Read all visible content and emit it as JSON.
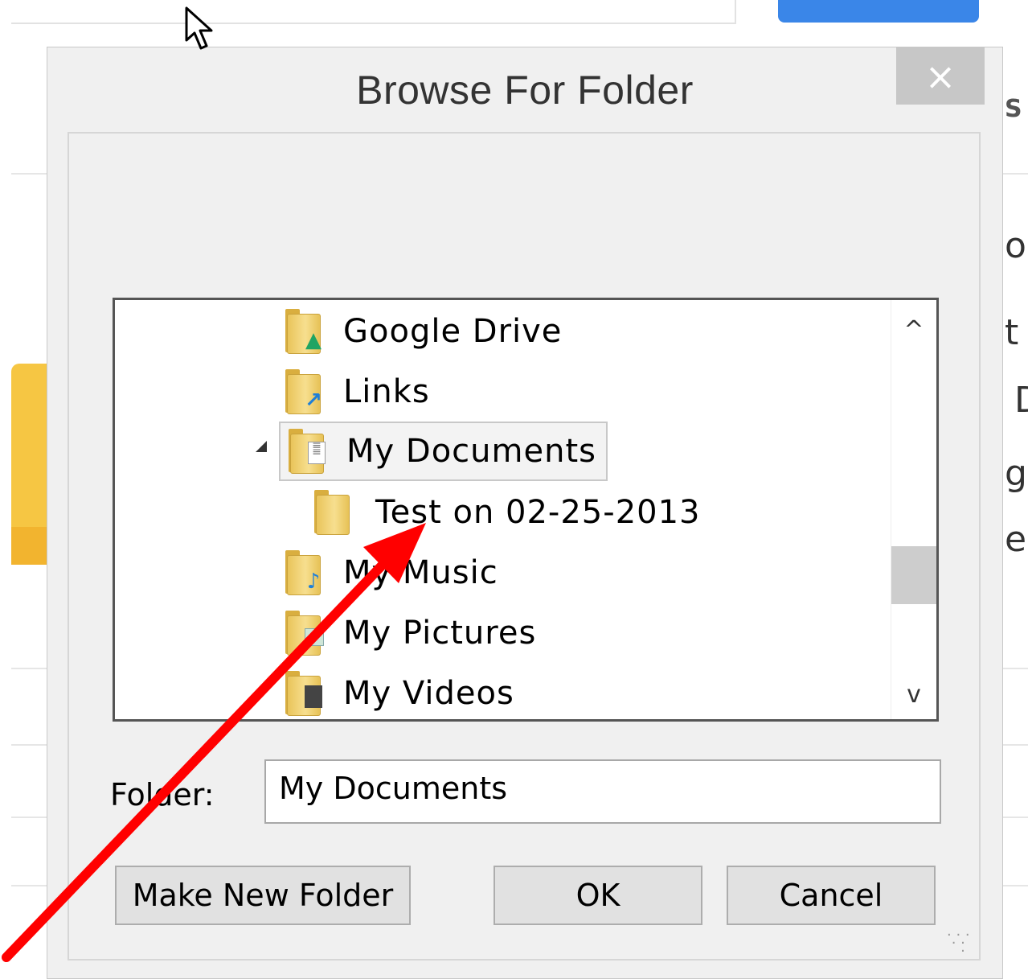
{
  "dialog": {
    "title": "Browse For Folder",
    "close_label": "×"
  },
  "tree": {
    "items": [
      {
        "label": "Google Drive",
        "icon": "google-drive-folder-icon"
      },
      {
        "label": "Links",
        "icon": "links-folder-icon"
      },
      {
        "label": "My Documents",
        "icon": "documents-folder-icon",
        "selected": true,
        "expanded": true
      },
      {
        "label": "Test on 02-25-2013",
        "icon": "folder-icon"
      },
      {
        "label": "My Music",
        "icon": "music-folder-icon"
      },
      {
        "label": "My Pictures",
        "icon": "pictures-folder-icon"
      },
      {
        "label": "My Videos",
        "icon": "videos-folder-icon"
      }
    ],
    "scroll_up": "^",
    "scroll_down": "v"
  },
  "folder_field": {
    "label": "Folder:",
    "value": "My Documents"
  },
  "buttons": {
    "make_new_folder": "Make New Folder",
    "ok": "OK",
    "cancel": "Cancel"
  },
  "background": {
    "fragments": [
      "S",
      "oi",
      "t",
      "D",
      "gl",
      "e"
    ]
  },
  "colors": {
    "annotation_arrow": "#ff0000",
    "accent_button": "#3a86e8"
  }
}
